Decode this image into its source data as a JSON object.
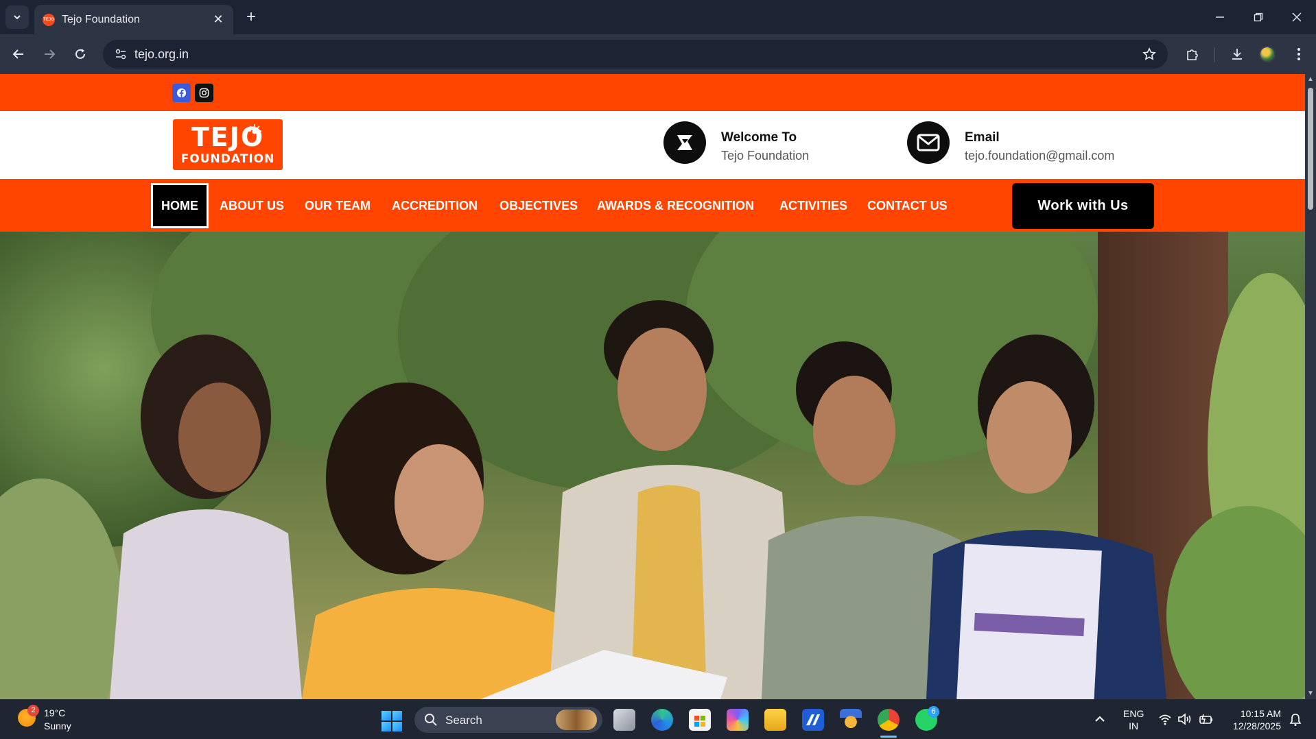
{
  "browser": {
    "tab_title": "Tejo Foundation",
    "favicon_text": "TEJO",
    "url": "tejo.org.in"
  },
  "site": {
    "logo": {
      "main": "TEJO",
      "sub": "FOUNDATION"
    },
    "welcome": {
      "title": "Welcome To",
      "subtitle": "Tejo Foundation"
    },
    "email": {
      "title": "Email",
      "address": "tejo.foundation@gmail.com"
    },
    "nav": [
      {
        "label": "HOME",
        "active": true
      },
      {
        "label": "ABOUT US"
      },
      {
        "label": "OUR TEAM"
      },
      {
        "label": "ACCREDITION"
      },
      {
        "label": "OBJECTIVES"
      },
      {
        "label": "AWARDS & RECOGNITION"
      },
      {
        "label": "ACTIVITIES"
      },
      {
        "label": "CONTACT US"
      }
    ],
    "cta_label": "Work with Us",
    "colors": {
      "brand_orange": "#ff4500",
      "black": "#000000"
    },
    "icons": [
      "facebook-icon",
      "instagram-icon",
      "logo-mark-icon",
      "envelope-icon"
    ]
  },
  "taskbar": {
    "weather": {
      "badge": "2",
      "temp": "19°C",
      "desc": "Sunny"
    },
    "search_label": "Search",
    "whatsapp_badge": "6",
    "lang": {
      "line1": "ENG",
      "line2": "IN"
    },
    "clock": {
      "time": "10:15 AM",
      "date": "12/28/2025"
    }
  }
}
